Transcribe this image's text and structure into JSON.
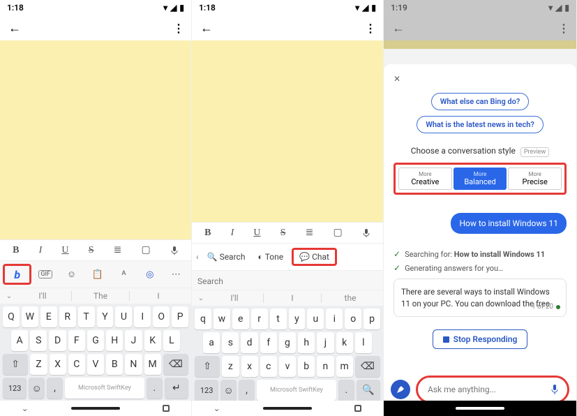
{
  "status": {
    "time": "1:18",
    "time3": "1:19"
  },
  "fmt": {
    "b": "B",
    "i": "I",
    "u": "U",
    "s": "S"
  },
  "p1": {
    "icons": {
      "bing": "b"
    },
    "sug": {
      "a": "I'll",
      "b": "The",
      "c": "I"
    }
  },
  "p2": {
    "modes": {
      "search": "Search",
      "tone": "Tone",
      "chat": "Chat"
    },
    "search_ph": "Search",
    "sug": {
      "a": "I'll",
      "b": "I",
      "c": "the"
    }
  },
  "kb": {
    "r1": [
      "Q",
      "W",
      "E",
      "R",
      "T",
      "Y",
      "U",
      "I",
      "O",
      "P"
    ],
    "r1l": [
      "q",
      "w",
      "e",
      "r",
      "t",
      "y",
      "u",
      "i",
      "o",
      "p"
    ],
    "r2": [
      "A",
      "S",
      "D",
      "F",
      "G",
      "H",
      "J",
      "K",
      "L"
    ],
    "r2l": [
      "a",
      "s",
      "d",
      "f",
      "g",
      "h",
      "j",
      "k",
      "l"
    ],
    "r3": [
      "Z",
      "X",
      "C",
      "V",
      "B",
      "N",
      "M"
    ],
    "r3l": [
      "z",
      "x",
      "c",
      "v",
      "b",
      "n",
      "m"
    ],
    "num": "123",
    "space": "Microsoft SwiftKey"
  },
  "p3": {
    "chip1": "What else can Bing do?",
    "chip2": "What is the latest news in tech?",
    "styletitle": "Choose a conversation style",
    "preview": "Preview",
    "more": "More",
    "creative": "Creative",
    "balanced": "Balanced",
    "precise": "Precise",
    "userq": "How to install Windows 11",
    "searching_pre": "Searching for: ",
    "searching_q": "How to install Windows 11",
    "generating": "Generating answers for you…",
    "response": "There are several ways to install Windows 11 on your PC. You can download the free",
    "count": "1 of 20",
    "stop": "Stop Responding",
    "ask_ph": "Ask me anything..."
  }
}
